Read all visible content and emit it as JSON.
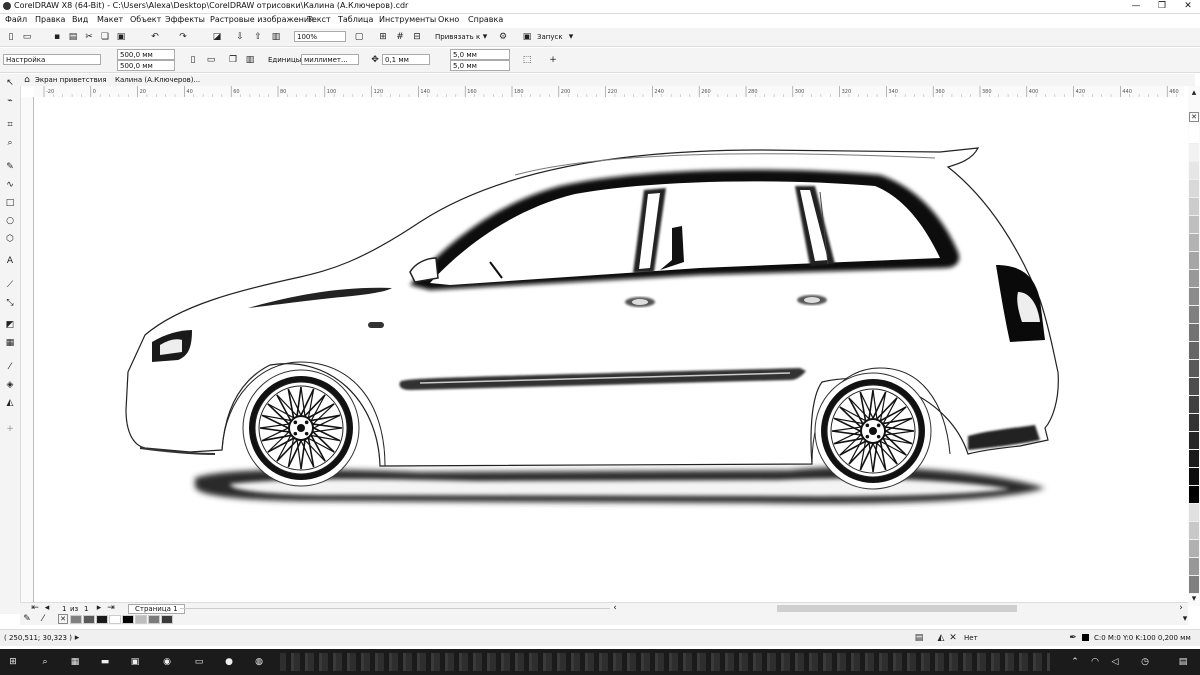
{
  "window": {
    "title": "CorelDRAW X8 (64-Bit) - C:\\Users\\Alexa\\Desktop\\CorelDRAW отрисовки\\Калина (А.Ключеров).cdr",
    "controls": [
      "—",
      "❐",
      "✕"
    ]
  },
  "menu": [
    "Файл",
    "Правка",
    "Вид",
    "Макет",
    "Объект",
    "Эффекты",
    "Растровые изображения",
    "Текст",
    "Таблица",
    "Инструменты",
    "Окно",
    "Справка"
  ],
  "standard_toolbar": {
    "zoom": "100%",
    "snap_label": "Привязать к",
    "launch_label": "Запуск"
  },
  "property_bar": {
    "preset": "Настройка",
    "width": "500,0 мм",
    "height": "500,0 мм",
    "units_label": "Единицы:",
    "units_value": "миллимет...",
    "nudge": "0,1 мм",
    "dup_x": "5,0 мм",
    "dup_y": "5,0 мм"
  },
  "tabs": [
    "Экран приветствия",
    "Калина (А.Ключеров)..."
  ],
  "ruler_ticks": [
    "-20",
    "0",
    "20",
    "40",
    "60",
    "80",
    "100",
    "120",
    "140",
    "160",
    "180",
    "200",
    "220",
    "240",
    "260",
    "280",
    "300",
    "320",
    "340",
    "360",
    "380",
    "400",
    "420",
    "440",
    "460"
  ],
  "ruler_unit": "миллиметры",
  "page_nav": {
    "current": "1",
    "of_label": "из",
    "total": "1",
    "page_tab": "Страница 1"
  },
  "status": {
    "coords": "( 250,511; 30,323 )",
    "fill_label": "Нет",
    "outline_label": "C:0 M:0 Y:0 K:100  0,200 мм"
  },
  "palette_colors": [
    "#ffffff",
    "#f2f2f2",
    "#e6e6e6",
    "#d9d9d9",
    "#cccccc",
    "#bfbfbf",
    "#b3b3b3",
    "#a6a6a6",
    "#999999",
    "#8c8c8c",
    "#808080",
    "#737373",
    "#666666",
    "#595959",
    "#4d4d4d",
    "#404040",
    "#333333",
    "#262626",
    "#1a1a1a",
    "#0d0d0d",
    "#000000",
    "#e0e0e0",
    "#c8c8c8",
    "#b0b0b0",
    "#989898",
    "#808080"
  ],
  "document_colors": [
    "#808080",
    "#595959",
    "#1a1a1a",
    "#ffffff",
    "#000000",
    "#bdbdbd",
    "#7a7a7a",
    "#3a3a3a"
  ],
  "icons": {
    "toolbox": [
      "pick-tool-icon",
      "shape-tool-icon",
      "crop-tool-icon",
      "zoom-tool-icon",
      "freehand-tool-icon",
      "artistic-media-icon",
      "rectangle-tool-icon",
      "ellipse-tool-icon",
      "polygon-tool-icon",
      "text-tool-icon",
      "parallel-dimension-icon",
      "connector-tool-icon",
      "drop-shadow-icon",
      "transparency-icon",
      "eyedropper-icon",
      "interactive-fill-icon",
      "smart-fill-icon",
      "add-tool-icon"
    ]
  }
}
